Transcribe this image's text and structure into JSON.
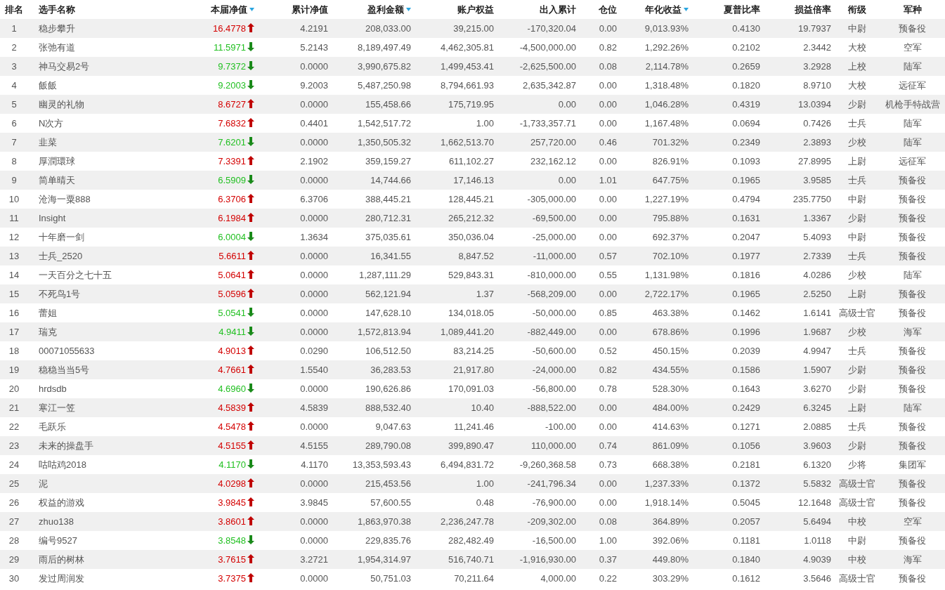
{
  "columns": [
    {
      "label": "排名",
      "sortable": false
    },
    {
      "label": "选手名称",
      "sortable": false
    },
    {
      "label": "本届净值",
      "sortable": true
    },
    {
      "label": "累计净值",
      "sortable": false
    },
    {
      "label": "盈利金额",
      "sortable": true
    },
    {
      "label": "账户权益",
      "sortable": false
    },
    {
      "label": "出入累计",
      "sortable": false
    },
    {
      "label": "仓位",
      "sortable": false
    },
    {
      "label": "年化收益",
      "sortable": true
    },
    {
      "label": "夏普比率",
      "sortable": false
    },
    {
      "label": "损益倍率",
      "sortable": false
    },
    {
      "label": "衔级",
      "sortable": false
    },
    {
      "label": "军种",
      "sortable": false
    }
  ],
  "rows": [
    {
      "rising": true,
      "cells": [
        "1",
        "稳步攀升",
        "16.4778",
        "4.2191",
        "208,033.00",
        "39,215.00",
        "-170,320.04",
        "0.00",
        "9,013.93%",
        "0.4130",
        "19.7937",
        "中尉",
        "预备役"
      ]
    },
    {
      "rising": false,
      "cells": [
        "2",
        "张弛有道",
        "11.5971",
        "5.2143",
        "8,189,497.49",
        "4,462,305.81",
        "-4,500,000.00",
        "0.82",
        "1,292.26%",
        "0.2102",
        "2.3442",
        "大校",
        "空军"
      ]
    },
    {
      "rising": false,
      "cells": [
        "3",
        "神马交易2号",
        "9.7372",
        "0.0000",
        "3,990,675.82",
        "1,499,453.41",
        "-2,625,500.00",
        "0.08",
        "2,114.78%",
        "0.2659",
        "3.2928",
        "上校",
        "陆军"
      ]
    },
    {
      "rising": false,
      "cells": [
        "4",
        "飯飯",
        "9.2003",
        "9.2003",
        "5,487,250.98",
        "8,794,661.93",
        "2,635,342.87",
        "0.00",
        "1,318.48%",
        "0.1820",
        "8.9710",
        "大校",
        "远征军"
      ]
    },
    {
      "rising": true,
      "cells": [
        "5",
        "幽灵的礼物",
        "8.6727",
        "0.0000",
        "155,458.66",
        "175,719.95",
        "0.00",
        "0.00",
        "1,046.28%",
        "0.4319",
        "13.0394",
        "少尉",
        "机枪手特战营"
      ]
    },
    {
      "rising": true,
      "cells": [
        "6",
        "N次方",
        "7.6832",
        "0.4401",
        "1,542,517.72",
        "1.00",
        "-1,733,357.71",
        "0.00",
        "1,167.48%",
        "0.0694",
        "0.7426",
        "士兵",
        "陆军"
      ]
    },
    {
      "rising": false,
      "cells": [
        "7",
        "韭菜",
        "7.6201",
        "0.0000",
        "1,350,505.32",
        "1,662,513.70",
        "257,720.00",
        "0.46",
        "701.32%",
        "0.2349",
        "2.3893",
        "少校",
        "陆军"
      ]
    },
    {
      "rising": true,
      "cells": [
        "8",
        "厚潤環球",
        "7.3391",
        "2.1902",
        "359,159.27",
        "611,102.27",
        "232,162.12",
        "0.00",
        "826.91%",
        "0.1093",
        "27.8995",
        "上尉",
        "远征军"
      ]
    },
    {
      "rising": false,
      "cells": [
        "9",
        "简单晴天",
        "6.5909",
        "0.0000",
        "14,744.66",
        "17,146.13",
        "0.00",
        "1.01",
        "647.75%",
        "0.1965",
        "3.9585",
        "士兵",
        "预备役"
      ]
    },
    {
      "rising": true,
      "cells": [
        "10",
        "沧海一粟888",
        "6.3706",
        "6.3706",
        "388,445.21",
        "128,445.21",
        "-305,000.00",
        "0.00",
        "1,227.19%",
        "0.4794",
        "235.7750",
        "中尉",
        "预备役"
      ]
    },
    {
      "rising": true,
      "cells": [
        "11",
        "Insight",
        "6.1984",
        "0.0000",
        "280,712.31",
        "265,212.32",
        "-69,500.00",
        "0.00",
        "795.88%",
        "0.1631",
        "1.3367",
        "少尉",
        "预备役"
      ]
    },
    {
      "rising": false,
      "cells": [
        "12",
        "十年磨一剑",
        "6.0004",
        "1.3634",
        "375,035.61",
        "350,036.04",
        "-25,000.00",
        "0.00",
        "692.37%",
        "0.2047",
        "5.4093",
        "中尉",
        "预备役"
      ]
    },
    {
      "rising": true,
      "cells": [
        "13",
        "士兵_2520",
        "5.6611",
        "0.0000",
        "16,341.55",
        "8,847.52",
        "-11,000.00",
        "0.57",
        "702.10%",
        "0.1977",
        "2.7339",
        "士兵",
        "预备役"
      ]
    },
    {
      "rising": true,
      "cells": [
        "14",
        "一天百分之七十五",
        "5.0641",
        "0.0000",
        "1,287,111.29",
        "529,843.31",
        "-810,000.00",
        "0.55",
        "1,131.98%",
        "0.1816",
        "4.0286",
        "少校",
        "陆军"
      ]
    },
    {
      "rising": true,
      "cells": [
        "15",
        "不死鸟1号",
        "5.0596",
        "0.0000",
        "562,121.94",
        "1.37",
        "-568,209.00",
        "0.00",
        "2,722.17%",
        "0.1965",
        "2.5250",
        "上尉",
        "预备役"
      ]
    },
    {
      "rising": false,
      "cells": [
        "16",
        "蕾姐",
        "5.0541",
        "0.0000",
        "147,628.10",
        "134,018.05",
        "-50,000.00",
        "0.85",
        "463.38%",
        "0.1462",
        "1.6141",
        "高级士官",
        "预备役"
      ]
    },
    {
      "rising": false,
      "cells": [
        "17",
        "瑞克",
        "4.9411",
        "0.0000",
        "1,572,813.94",
        "1,089,441.20",
        "-882,449.00",
        "0.00",
        "678.86%",
        "0.1996",
        "1.9687",
        "少校",
        "海军"
      ]
    },
    {
      "rising": true,
      "cells": [
        "18",
        "00071055633",
        "4.9013",
        "0.0290",
        "106,512.50",
        "83,214.25",
        "-50,600.00",
        "0.52",
        "450.15%",
        "0.2039",
        "4.9947",
        "士兵",
        "预备役"
      ]
    },
    {
      "rising": true,
      "cells": [
        "19",
        "稳稳当当5号",
        "4.7661",
        "1.5540",
        "36,283.53",
        "21,917.80",
        "-24,000.00",
        "0.82",
        "434.55%",
        "0.1586",
        "1.5907",
        "少尉",
        "预备役"
      ]
    },
    {
      "rising": false,
      "cells": [
        "20",
        "hrdsdb",
        "4.6960",
        "0.0000",
        "190,626.86",
        "170,091.03",
        "-56,800.00",
        "0.78",
        "528.30%",
        "0.1643",
        "3.6270",
        "少尉",
        "预备役"
      ]
    },
    {
      "rising": true,
      "cells": [
        "21",
        "寒江一笠",
        "4.5839",
        "4.5839",
        "888,532.40",
        "10.40",
        "-888,522.00",
        "0.00",
        "484.00%",
        "0.2429",
        "6.3245",
        "上尉",
        "陆军"
      ]
    },
    {
      "rising": true,
      "cells": [
        "22",
        "毛跃乐",
        "4.5478",
        "0.0000",
        "9,047.63",
        "11,241.46",
        "-100.00",
        "0.00",
        "414.63%",
        "0.1271",
        "2.0885",
        "士兵",
        "预备役"
      ]
    },
    {
      "rising": true,
      "cells": [
        "23",
        "未来的操盘手",
        "4.5155",
        "4.5155",
        "289,790.08",
        "399,890.47",
        "110,000.00",
        "0.74",
        "861.09%",
        "0.1056",
        "3.9603",
        "少尉",
        "预备役"
      ]
    },
    {
      "rising": false,
      "cells": [
        "24",
        "咕咕鸡2018",
        "4.1170",
        "4.1170",
        "13,353,593.43",
        "6,494,831.72",
        "-9,260,368.58",
        "0.73",
        "668.38%",
        "0.2181",
        "6.1320",
        "少将",
        "集团军"
      ]
    },
    {
      "rising": true,
      "cells": [
        "25",
        "泥",
        "4.0298",
        "0.0000",
        "215,453.56",
        "1.00",
        "-241,796.34",
        "0.00",
        "1,237.33%",
        "0.1372",
        "5.5832",
        "高级士官",
        "预备役"
      ]
    },
    {
      "rising": true,
      "cells": [
        "26",
        "权益的游戏",
        "3.9845",
        "3.9845",
        "57,600.55",
        "0.48",
        "-76,900.00",
        "0.00",
        "1,918.14%",
        "0.5045",
        "12.1648",
        "高级士官",
        "预备役"
      ]
    },
    {
      "rising": true,
      "cells": [
        "27",
        "zhuo138",
        "3.8601",
        "0.0000",
        "1,863,970.38",
        "2,236,247.78",
        "-209,302.00",
        "0.08",
        "364.89%",
        "0.2057",
        "5.6494",
        "中校",
        "空军"
      ]
    },
    {
      "rising": false,
      "cells": [
        "28",
        "编号9527",
        "3.8548",
        "0.0000",
        "229,835.76",
        "282,482.49",
        "-16,500.00",
        "1.00",
        "392.06%",
        "0.1181",
        "1.0118",
        "中尉",
        "预备役"
      ]
    },
    {
      "rising": true,
      "cells": [
        "29",
        "雨后的树林",
        "3.7615",
        "3.2721",
        "1,954,314.97",
        "516,740.71",
        "-1,916,930.00",
        "0.37",
        "449.80%",
        "0.1840",
        "4.9039",
        "中校",
        "海军"
      ]
    },
    {
      "rising": true,
      "cells": [
        "30",
        "发过周润发",
        "3.7375",
        "0.0000",
        "50,751.03",
        "70,211.64",
        "4,000.00",
        "0.22",
        "303.29%",
        "0.1612",
        "3.5646",
        "高级士官",
        "预备役"
      ]
    }
  ]
}
